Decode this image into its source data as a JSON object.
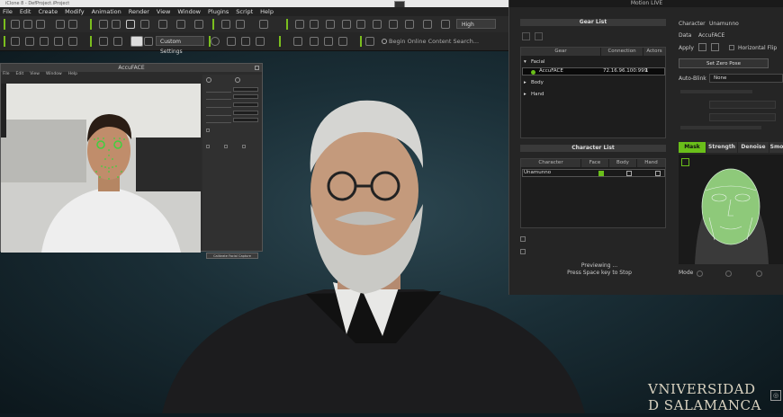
{
  "window": {
    "title": "iClone 8 - DefProject.iProject",
    "menu": [
      "File",
      "Edit",
      "Create",
      "Modify",
      "Animation",
      "Render",
      "View",
      "Window",
      "Plugins",
      "Script",
      "Help"
    ]
  },
  "toolbar": {
    "quality": "High",
    "custom_settings": "Custom Settings",
    "search_placeholder": "Begin Online Content Search..."
  },
  "accuface": {
    "title": "AccuFACE",
    "menu": [
      "File",
      "Edit",
      "View",
      "Window",
      "Help"
    ],
    "calibrate_button": "Calibrate Facial Capture"
  },
  "motion_live": {
    "title": "Motion LIVE",
    "gear_list": {
      "title": "Gear List",
      "columns": [
        "Gear",
        "Connection",
        "Actors"
      ],
      "groups": [
        "Facial",
        "Body",
        "Hand"
      ],
      "device": {
        "name": "AccuFACE",
        "connection": "72.16.96.100:999",
        "actors": "1"
      }
    },
    "character_list": {
      "title": "Character List",
      "columns": [
        "Character",
        "Face",
        "Body",
        "Hand"
      ],
      "rows": [
        {
          "name": "Unamunno"
        }
      ]
    },
    "status": {
      "line1": "Previewing ...",
      "line2": "Press Space key to Stop"
    },
    "props": {
      "character_label": "Character",
      "character_value": "Unamunno",
      "data_label": "Data",
      "data_value": "AccuFACE",
      "apply_label": "Apply",
      "horizontal_flip": "Horizontal Flip",
      "zero_pose": "Set Zero Pose",
      "auto_blink_label": "Auto-Blink",
      "auto_blink_value": "None"
    },
    "tabs": [
      "Mask",
      "Strength",
      "Denoise",
      "Smo"
    ],
    "mode_label": "Mode"
  },
  "logo": {
    "line1": "VNIVERSIDAD",
    "line2": "D SALAMANCA"
  },
  "colors": {
    "accent": "#6abf1a",
    "panel": "#252525"
  }
}
